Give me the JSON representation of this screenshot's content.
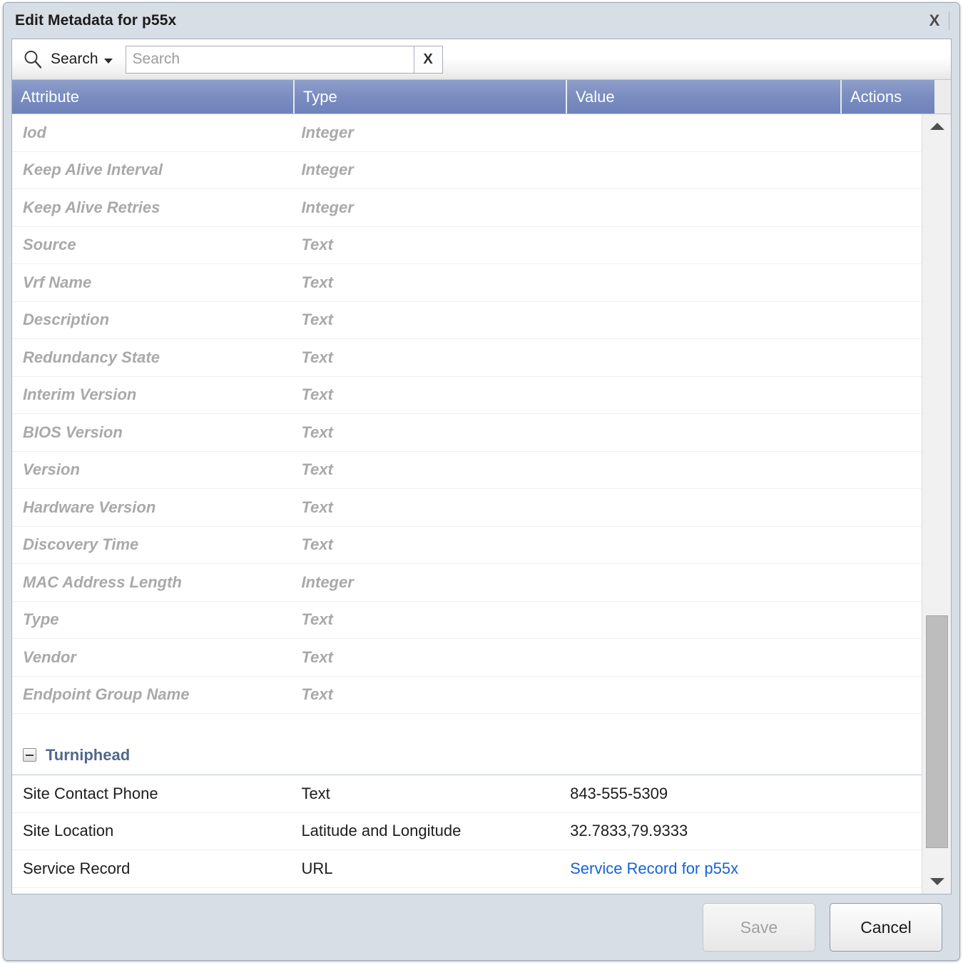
{
  "dialog": {
    "title": "Edit Metadata for p55x",
    "close_icon": "close-icon",
    "close_label": "X"
  },
  "toolbar": {
    "search_icon": "search-icon",
    "search_label": "Search",
    "dropdown_icon": "chevron-down-icon",
    "search_value": "",
    "search_placeholder": "Search",
    "clear_label": "X"
  },
  "grid": {
    "columns": {
      "attribute": "Attribute",
      "type": "Type",
      "value": "Value",
      "actions": "Actions"
    },
    "readonly_rows": [
      {
        "attribute": "Iod",
        "type": "Integer",
        "value": "",
        "actions": ""
      },
      {
        "attribute": "Keep Alive Interval",
        "type": "Integer",
        "value": "",
        "actions": ""
      },
      {
        "attribute": "Keep Alive Retries",
        "type": "Integer",
        "value": "",
        "actions": ""
      },
      {
        "attribute": "Source",
        "type": "Text",
        "value": "",
        "actions": ""
      },
      {
        "attribute": "Vrf Name",
        "type": "Text",
        "value": "",
        "actions": ""
      },
      {
        "attribute": "Description",
        "type": "Text",
        "value": "",
        "actions": ""
      },
      {
        "attribute": "Redundancy State",
        "type": "Text",
        "value": "",
        "actions": ""
      },
      {
        "attribute": "Interim Version",
        "type": "Text",
        "value": "",
        "actions": ""
      },
      {
        "attribute": "BIOS Version",
        "type": "Text",
        "value": "",
        "actions": ""
      },
      {
        "attribute": "Version",
        "type": "Text",
        "value": "",
        "actions": ""
      },
      {
        "attribute": "Hardware Version",
        "type": "Text",
        "value": "",
        "actions": ""
      },
      {
        "attribute": "Discovery Time",
        "type": "Text",
        "value": "",
        "actions": ""
      },
      {
        "attribute": "MAC Address Length",
        "type": "Integer",
        "value": "",
        "actions": ""
      },
      {
        "attribute": "Type",
        "type": "Text",
        "value": "",
        "actions": ""
      },
      {
        "attribute": "Vendor",
        "type": "Text",
        "value": "",
        "actions": ""
      },
      {
        "attribute": "Endpoint Group Name",
        "type": "Text",
        "value": "",
        "actions": ""
      }
    ],
    "group": {
      "name": "Turniphead",
      "toggle_icon": "collapse-minus-icon",
      "expanded": true,
      "rows": [
        {
          "attribute": "Site Contact Phone",
          "type": "Text",
          "value": "843-555-5309",
          "is_link": false,
          "actions": ""
        },
        {
          "attribute": "Site Location",
          "type": "Latitude and Longitude",
          "value": "32.7833,79.9333",
          "is_link": false,
          "actions": ""
        },
        {
          "attribute": "Service Record",
          "type": "URL",
          "value": "Service Record for p55x",
          "is_link": true,
          "actions": ""
        }
      ]
    },
    "scrollbar": {
      "up_icon": "scroll-up-arrow-icon",
      "down_icon": "scroll-down-arrow-icon"
    }
  },
  "footer": {
    "save_label": "Save",
    "save_disabled": true,
    "cancel_label": "Cancel"
  },
  "colors": {
    "header_blue": "#7a8cc0",
    "chrome": "#d8dee6",
    "link": "#1463d8",
    "group_text": "#51688c",
    "readonly_text": "#a9a9a9"
  }
}
